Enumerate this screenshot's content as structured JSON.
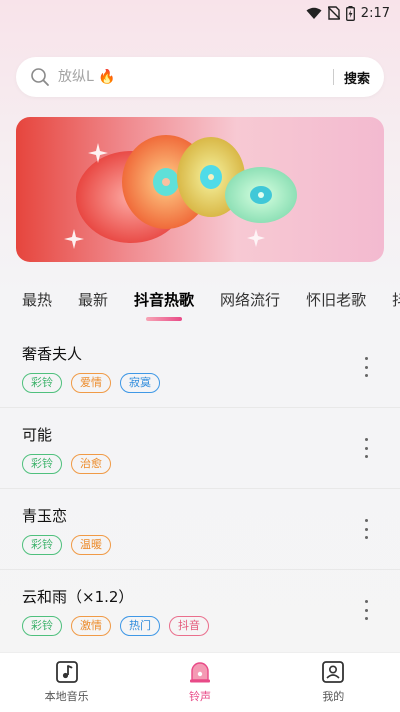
{
  "status_bar": {
    "time": "2:17"
  },
  "search": {
    "placeholder": "放纵L 🔥",
    "button_label": "搜索"
  },
  "tabs": [
    {
      "label": "最热"
    },
    {
      "label": "最新"
    },
    {
      "label": "抖音热歌"
    },
    {
      "label": "网络流行"
    },
    {
      "label": "怀旧老歌"
    },
    {
      "label": "抖"
    }
  ],
  "active_tab": "抖音热歌",
  "songs": [
    {
      "title": "奢香夫人",
      "tags": [
        "彩铃",
        "爱情",
        "寂寞"
      ]
    },
    {
      "title": "可能",
      "tags": [
        "彩铃",
        "治愈"
      ]
    },
    {
      "title": "青玉恋",
      "tags": [
        "彩铃",
        "温暖"
      ]
    },
    {
      "title": "云和雨（×1.2）",
      "tags": [
        "彩铃",
        "激情",
        "热门",
        "抖音"
      ]
    }
  ],
  "bottom_nav": [
    {
      "label": "本地音乐",
      "icon": "music-note-icon"
    },
    {
      "label": "铃声",
      "icon": "bell-icon"
    },
    {
      "label": "我的",
      "icon": "profile-icon"
    }
  ],
  "colors": {
    "accent": "#e84a87",
    "tag_green": "#3fb36c",
    "tag_orange": "#ec8b2b",
    "tag_blue": "#2e8bdc",
    "tag_pink": "#e55a7b"
  }
}
